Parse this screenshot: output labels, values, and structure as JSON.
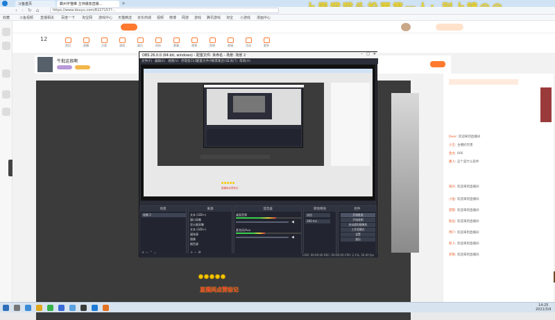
{
  "browser": {
    "tabs": [
      {
        "label": "斗鱼首页"
      },
      {
        "label": "霸州宇猫推 主持播放直播..."
      }
    ],
    "url": "https://www.douyu.com/8227157?...",
    "bookmarks": [
      "收藏",
      "斗鱼视频",
      "直播相关",
      "百度一下",
      "淘宝网",
      "游戏中心",
      "天猫精选",
      "京东商城",
      "视频",
      "微博",
      "网游",
      "游戏",
      "腾讯游戏",
      "淘宝",
      "小游戏",
      "漫画中心"
    ]
  },
  "overlay": {
    "title": "上周猫猫头投票第一人: 别上镜@@"
  },
  "site": {
    "categories": [
      "首页",
      "直播",
      "分类",
      "游戏",
      "娱乐",
      "科技",
      "赛事",
      "视频",
      "鱼吧",
      "商城",
      "活动",
      "更多"
    ],
    "streamer_name": "牛批这孩啊",
    "chat_lines": [
      {
        "user": "Deer",
        "text": "欢迎来到直播间"
      },
      {
        "user": "小王",
        "text": "主播好厉害"
      },
      {
        "user": "鱼丸",
        "text": "666"
      },
      {
        "user": "路人",
        "text": "这个是什么软件"
      },
      {
        "user": "观众",
        "text": "欢迎来到直播间"
      },
      {
        "user": "小鱼",
        "text": "欢迎来到直播间"
      },
      {
        "user": "游客",
        "text": "欢迎来到直播间"
      },
      {
        "user": "粉丝",
        "text": "欢迎来到直播间"
      },
      {
        "user": "用户",
        "text": "欢迎来到直播间"
      },
      {
        "user": "新人",
        "text": "欢迎来到直播间"
      },
      {
        "user": "老铁",
        "text": "欢迎来到直播间"
      }
    ]
  },
  "obs": {
    "title": "OBS 26.0.0 (64-bit, windows) - 配置文件: 未命名 - 场景: 场景 2",
    "menu": [
      "文件(F)",
      "编辑(E)",
      "视图(V)",
      "停靠窗口(D)",
      "配置文件(P)",
      "场景集合(S)",
      "工具(T)",
      "帮助(H)"
    ],
    "docks": {
      "scenes": "场景",
      "sources": "来源",
      "mixer": "混音器",
      "transitions": "转场特效",
      "controls": "控件"
    },
    "scene_item": "场景 2",
    "sources_list": [
      "文本 (GDI+)",
      "窗口采集",
      "显示器采集",
      "文本 (GDI+)",
      "媒体源",
      "图像",
      "颜色源",
      "浏览器"
    ],
    "mixer_tracks": [
      "桌面音频",
      "麦克风/Aux"
    ],
    "mixer_levels": [
      0.62,
      0.45
    ],
    "transition_type": "淡出",
    "transition_duration": "300 ms",
    "controls": [
      "开始推流",
      "开始录制",
      "启动虚拟摄像机",
      "工作室模式",
      "设置",
      "退出"
    ],
    "status": "LIVE: 00:00:00  REC: 00:00:00  CPU: 2.1%, 30.00 fps",
    "live_caption": "直播间点赞标记"
  },
  "stream_caption": "直播间点赞标记",
  "taskbar": {
    "time": "14:25",
    "date": "2021/3/9"
  },
  "colors": {
    "accent": "#ff7a2f",
    "obs_bg": "#2b2e38"
  }
}
